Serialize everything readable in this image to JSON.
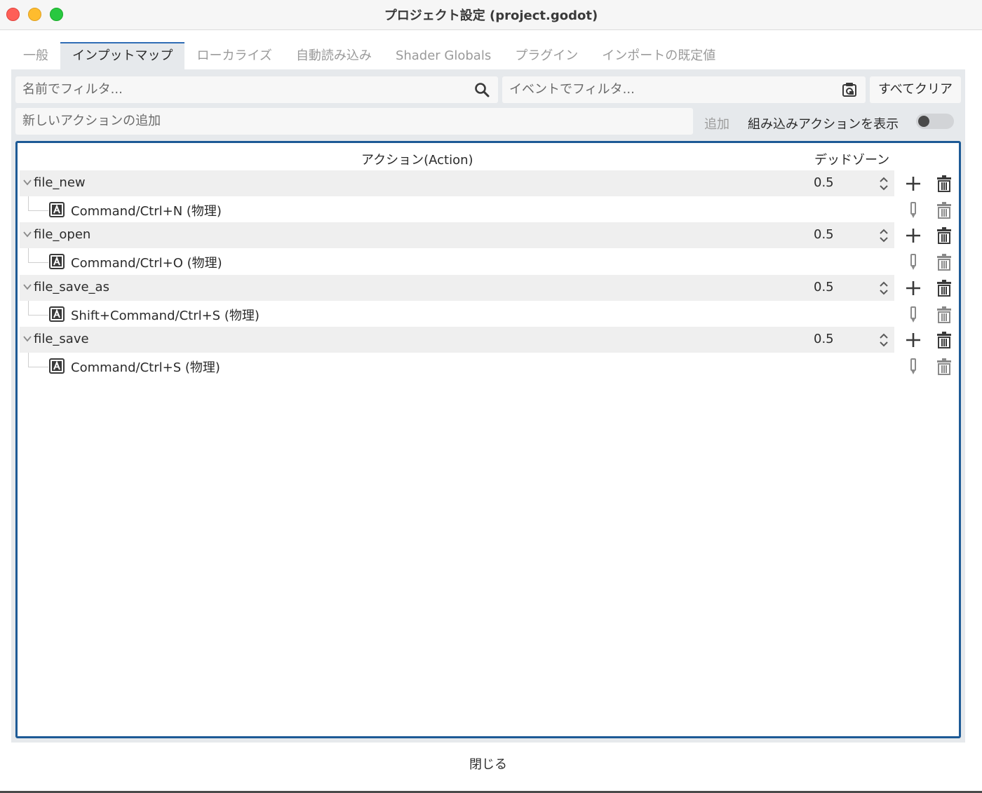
{
  "window": {
    "title": "プロジェクト設定 (project.godot)"
  },
  "tabs": [
    {
      "label": "一般",
      "active": false
    },
    {
      "label": "インプットマップ",
      "active": true
    },
    {
      "label": "ローカライズ",
      "active": false
    },
    {
      "label": "自動読み込み",
      "active": false
    },
    {
      "label": "Shader Globals",
      "active": false
    },
    {
      "label": "プラグイン",
      "active": false
    },
    {
      "label": "インポートの既定値",
      "active": false
    }
  ],
  "filters": {
    "name_placeholder": "名前でフィルタ...",
    "event_placeholder": "イベントでフィルタ...",
    "clear_all_label": "すべてクリア"
  },
  "new_action": {
    "placeholder": "新しいアクションの追加",
    "add_label": "追加",
    "show_builtin_label": "組み込みアクションを表示",
    "show_builtin_on": false
  },
  "tree": {
    "col_action": "アクション(Action)",
    "col_deadzone": "デッドゾーン",
    "actions": [
      {
        "name": "file_new",
        "deadzone": "0.5",
        "event": "Command/Ctrl+N (物理)"
      },
      {
        "name": "file_open",
        "deadzone": "0.5",
        "event": "Command/Ctrl+O (物理)"
      },
      {
        "name": "file_save_as",
        "deadzone": "0.5",
        "event": "Shift+Command/Ctrl+S (物理)"
      },
      {
        "name": "file_save",
        "deadzone": "0.5",
        "event": "Command/Ctrl+S (物理)"
      }
    ]
  },
  "footer": {
    "close_label": "閉じる"
  },
  "colors": {
    "accent": "#1d5a96",
    "panel_bg": "#e6e9ec",
    "action_row_bg": "#efefef"
  }
}
